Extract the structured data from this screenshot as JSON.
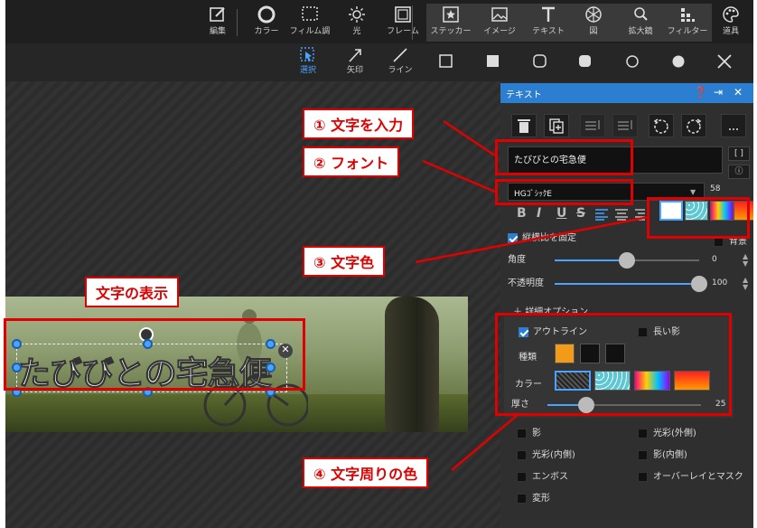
{
  "toolbar": {
    "tools": [
      {
        "label": "編集",
        "icon": "edit-icon"
      },
      {
        "label": "カラー",
        "icon": "color-icon"
      },
      {
        "label": "フィルム調",
        "icon": "film-icon"
      },
      {
        "label": "光",
        "icon": "light-icon"
      },
      {
        "label": "フレーム",
        "icon": "frame-icon"
      },
      {
        "label": "ステッカー",
        "icon": "sticker-icon"
      },
      {
        "label": "イメージ",
        "icon": "image-icon"
      },
      {
        "label": "テキスト",
        "icon": "text-icon"
      },
      {
        "label": "図",
        "icon": "shape-icon"
      },
      {
        "label": "拡大鏡",
        "icon": "magnifier-icon"
      },
      {
        "label": "フィルター",
        "icon": "filter-icon"
      },
      {
        "label": "道具",
        "icon": "palette-icon"
      }
    ]
  },
  "subtoolbar": {
    "select_label": "選択",
    "arrow_label": "矢印",
    "line_label": "ライン"
  },
  "canvas": {
    "photo_text": "たびびとの宅急便"
  },
  "panel": {
    "title": "テキスト",
    "text_value": "たびびとの宅急便",
    "bracket_label": "[ ]",
    "font_name": "HGｺﾞｼｯｸE",
    "font_size": "58",
    "format_buttons": [
      "B",
      "I",
      "U",
      "S"
    ],
    "lock_ratio_label": "縦横比を固定",
    "background_label": "背景",
    "angle_label": "角度",
    "angle_value": "0",
    "angle_fraction": 0.5,
    "opacity_label": "不透明度",
    "opacity_value": "100",
    "opacity_fraction": 1.0,
    "detail_label": "詳細オプション",
    "outline_label": "アウトライン",
    "long_shadow_label": "長い影",
    "type_label": "種類",
    "color_label": "カラー",
    "thickness_label": "厚さ",
    "thickness_value": "25",
    "thickness_fraction": 0.25,
    "effects": {
      "shadow": "影",
      "outer_glow": "光彩(外側)",
      "inner_glow": "光彩(内側)",
      "inner_shadow": "影(内側)",
      "emboss": "エンボス",
      "overlay_mask": "オーバーレイとマスク",
      "transform": "変形"
    }
  },
  "annotations": {
    "a1": "① 文字を入力",
    "a2": "② フォント",
    "a3": "③ 文字色",
    "a4": "④ 文字周りの色",
    "display": "文字の表示"
  },
  "colors": {
    "accent": "#2c7fd0",
    "annotation": "#e00000",
    "panel_bg": "#2f2f2f",
    "toolbar_bg": "#1f1f1f"
  }
}
